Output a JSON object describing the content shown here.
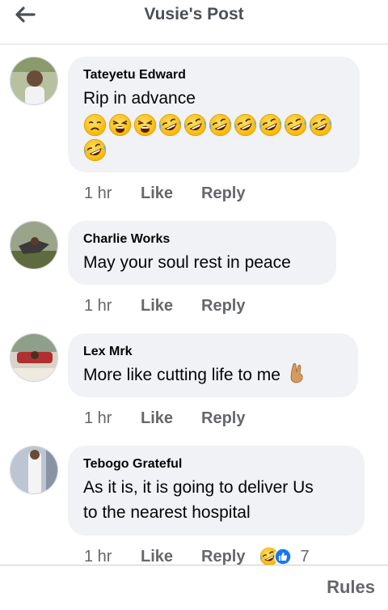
{
  "header": {
    "title": "Vusie's Post",
    "back_icon": "arrow-left-icon"
  },
  "comments": [
    {
      "author": "Tateyetu Edward",
      "text": "Rip in advance",
      "emojis": [
        "weary-face",
        "tired-face",
        "tired-face",
        "rofl",
        "rofl",
        "rofl",
        "rofl",
        "rofl",
        "rofl",
        "rofl",
        "rofl"
      ],
      "time": "1 hr",
      "like": "Like",
      "reply": "Reply"
    },
    {
      "author": "Charlie Works",
      "text": "May your soul rest in peace",
      "time": "1 hr",
      "like": "Like",
      "reply": "Reply"
    },
    {
      "author": "Lex Mrk",
      "text": "More like cutting life to me",
      "trailing_emoji": "crossed-fingers",
      "time": "1 hr",
      "like": "Like",
      "reply": "Reply"
    },
    {
      "author": "Tebogo Grateful",
      "text_line1": "As it is, it is going to deliver Us",
      "text_line2": "to the nearest hospital",
      "time": "1 hr",
      "like": "Like",
      "reply": "Reply",
      "reactions": [
        "haha",
        "like"
      ],
      "reaction_count": "7"
    }
  ],
  "footer": {
    "rules": "Rules"
  },
  "colors": {
    "bubble": "#f0f2f5",
    "meta": "#65676b",
    "title": "#4b4f56"
  }
}
